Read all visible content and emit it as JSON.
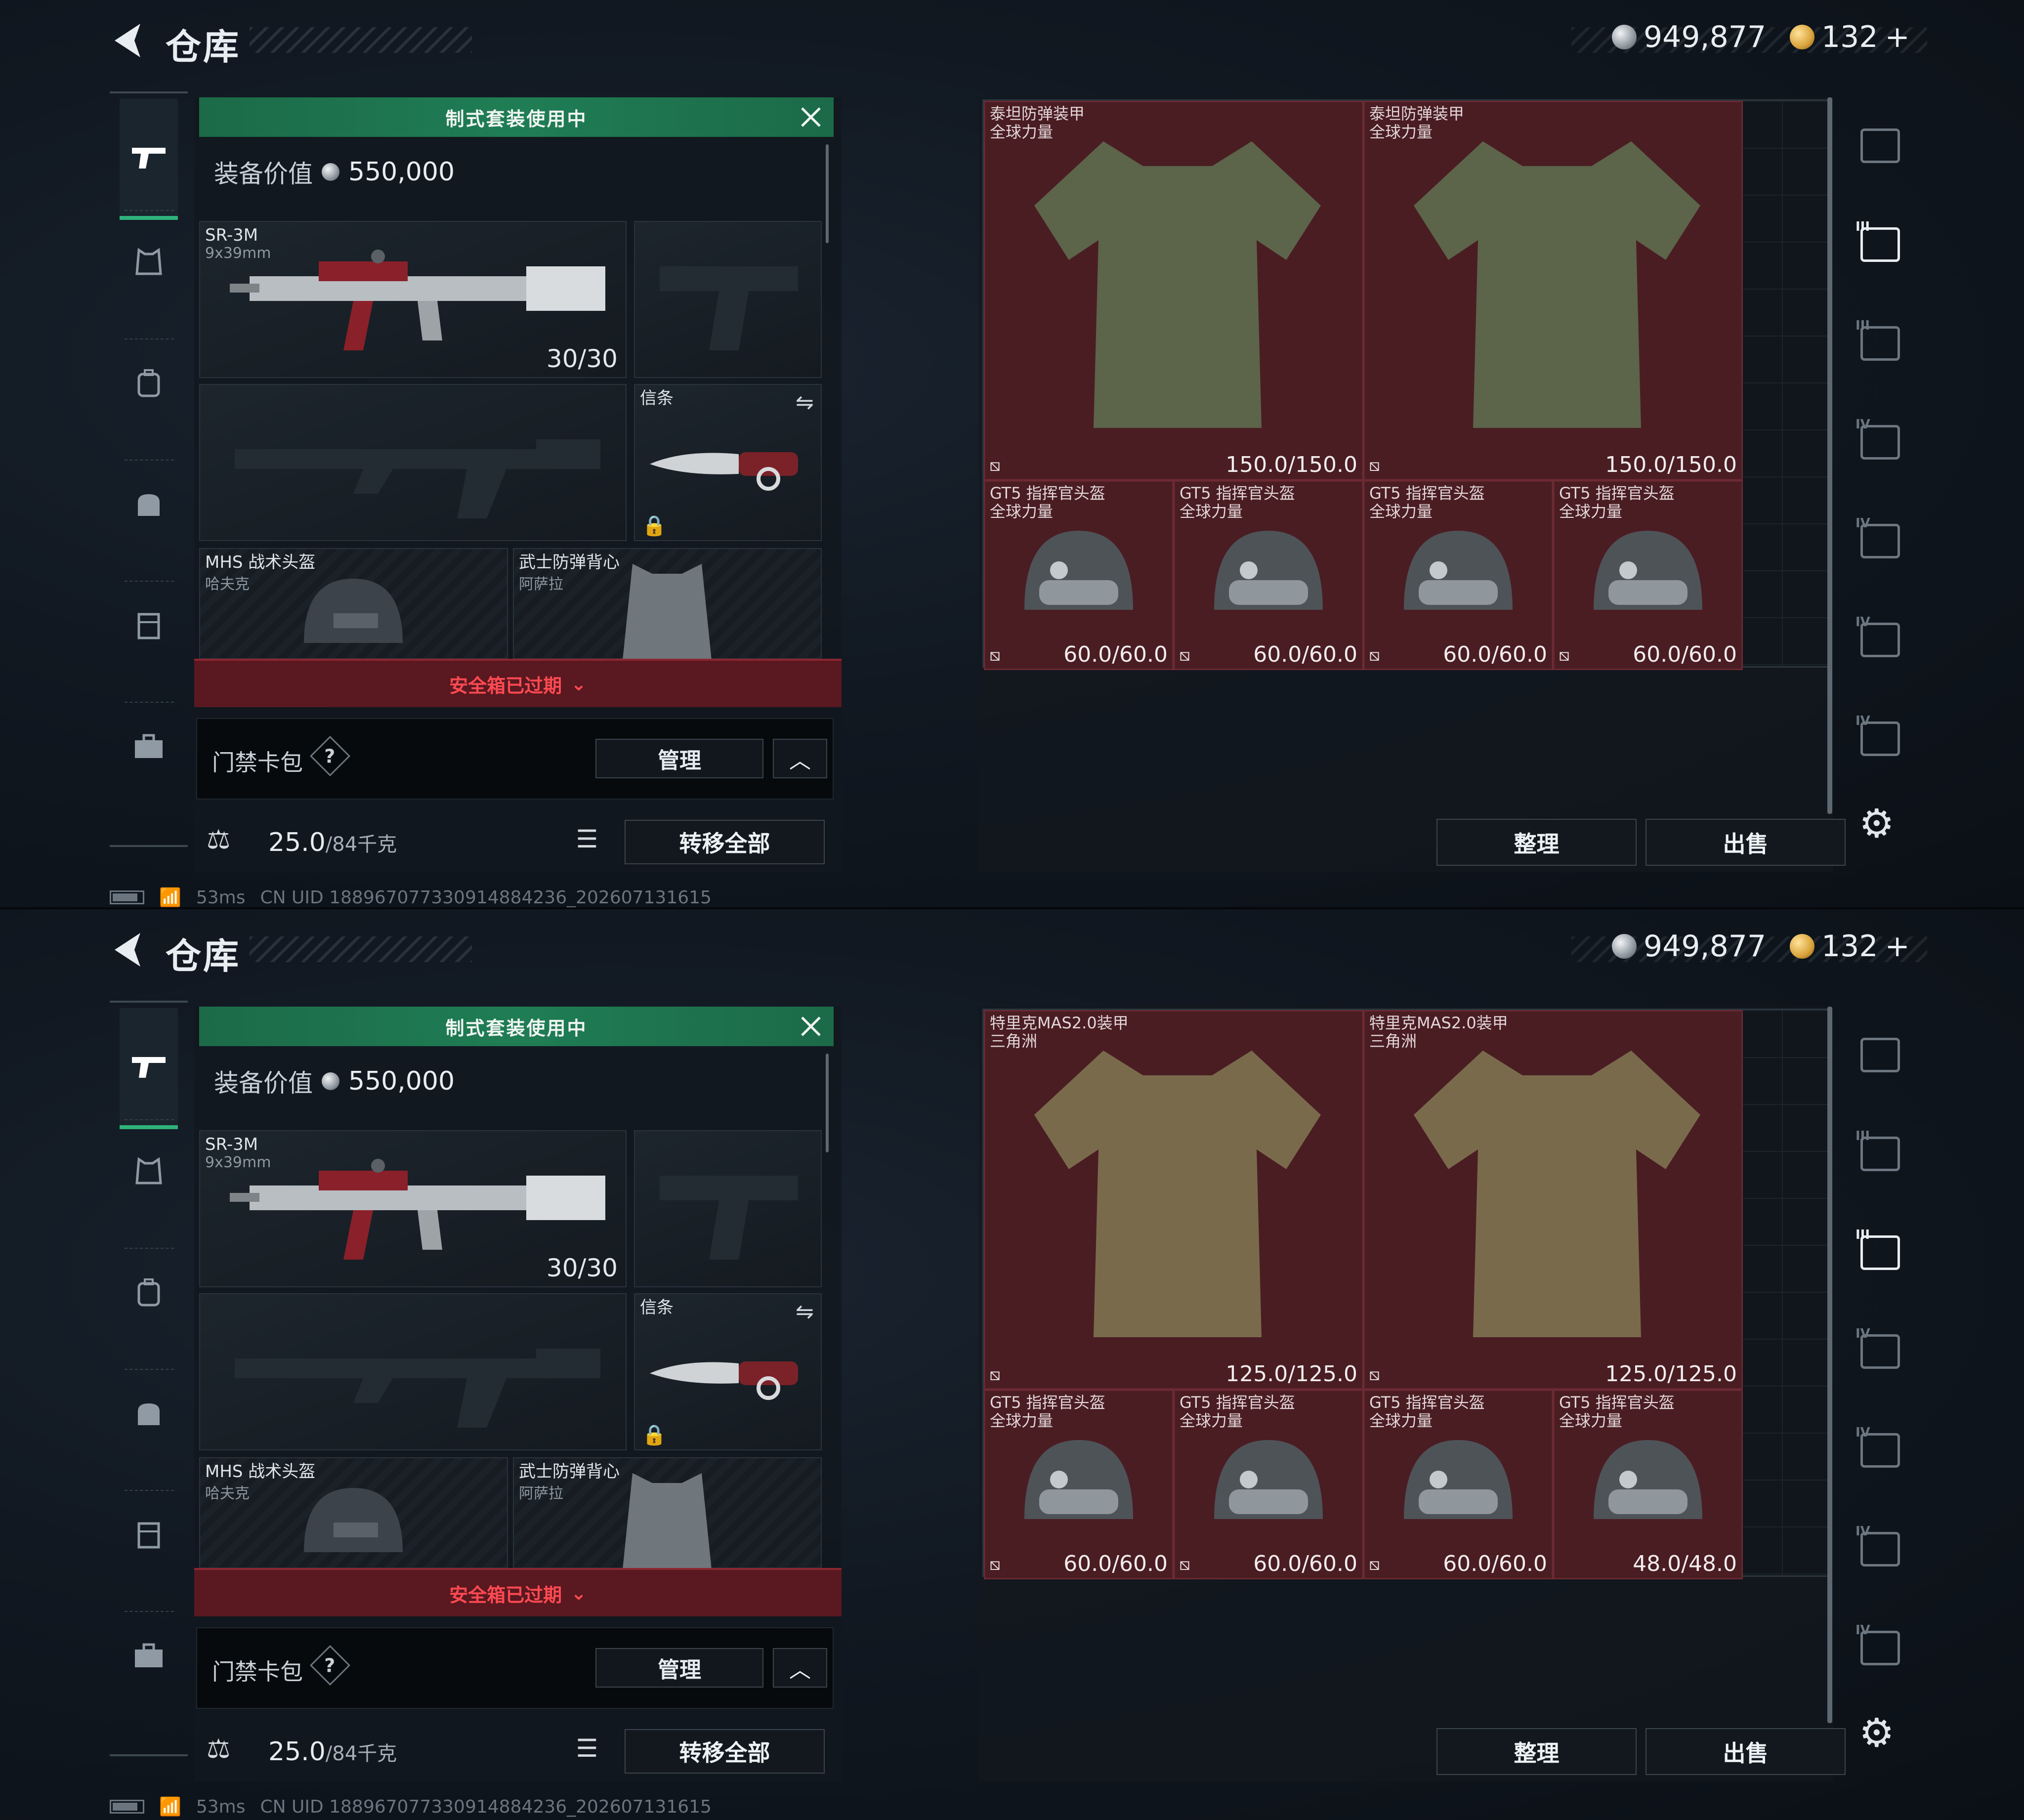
{
  "screens": [
    {
      "header": {
        "title": "仓库",
        "currency_silver": "949,877",
        "currency_gold": "132",
        "currency_plus": "+"
      },
      "loadout": {
        "banner": "制式套装使用中",
        "value_label": "装备价值",
        "value": "550,000",
        "primary": {
          "name": "SR-3M",
          "caliber": "9x39mm",
          "ammo": "30/30"
        },
        "melee": {
          "label": "信条"
        },
        "helmet": {
          "name": "MHS 战术头盔",
          "origin": "哈夫克"
        },
        "vest": {
          "name": "武士防弹背心",
          "origin": "阿萨拉"
        },
        "safe_box": "安全箱已过期",
        "card_pack": "门禁卡包",
        "help": "?",
        "manage": "管理",
        "weight": "25.0",
        "weight_cap": "/84千克",
        "transfer_all": "转移全部"
      },
      "status": {
        "ping": "53ms",
        "uid": "CN UID 188967077330914884236_202607131615"
      },
      "storage": {
        "armor": [
          {
            "name": "泰坦防弹装甲",
            "origin": "全球力量",
            "durability": "150.0/150.0"
          },
          {
            "name": "泰坦防弹装甲",
            "origin": "全球力量",
            "durability": "150.0/150.0"
          }
        ],
        "helmets": [
          {
            "name": "GT5 指挥官头盔",
            "origin": "全球力量",
            "durability": "60.0/60.0"
          },
          {
            "name": "GT5 指挥官头盔",
            "origin": "全球力量",
            "durability": "60.0/60.0"
          },
          {
            "name": "GT5 指挥官头盔",
            "origin": "全球力量",
            "durability": "60.0/60.0"
          },
          {
            "name": "GT5 指挥官头盔",
            "origin": "全球力量",
            "durability": "60.0/60.0"
          }
        ],
        "sort": "整理",
        "sell": "出售"
      },
      "rail": {
        "active_index": 1,
        "labels": [
          "",
          "III",
          "III",
          "IV",
          "IV",
          "IV",
          "IV"
        ]
      }
    },
    {
      "header": {
        "title": "仓库",
        "currency_silver": "949,877",
        "currency_gold": "132",
        "currency_plus": "+"
      },
      "loadout": {
        "banner": "制式套装使用中",
        "value_label": "装备价值",
        "value": "550,000",
        "primary": {
          "name": "SR-3M",
          "caliber": "9x39mm",
          "ammo": "30/30"
        },
        "melee": {
          "label": "信条"
        },
        "helmet": {
          "name": "MHS 战术头盔",
          "origin": "哈夫克"
        },
        "vest": {
          "name": "武士防弹背心",
          "origin": "阿萨拉"
        },
        "safe_box": "安全箱已过期",
        "card_pack": "门禁卡包",
        "help": "?",
        "manage": "管理",
        "weight": "25.0",
        "weight_cap": "/84千克",
        "transfer_all": "转移全部"
      },
      "status": {
        "ping": "53ms",
        "uid": "CN UID 188967077330914884236_202607131615"
      },
      "storage": {
        "armor": [
          {
            "name": "特里克MAS2.0装甲",
            "origin": "三角洲",
            "durability": "125.0/125.0"
          },
          {
            "name": "特里克MAS2.0装甲",
            "origin": "三角洲",
            "durability": "125.0/125.0"
          }
        ],
        "helmets": [
          {
            "name": "GT5 指挥官头盔",
            "origin": "全球力量",
            "durability": "60.0/60.0"
          },
          {
            "name": "GT5 指挥官头盔",
            "origin": "全球力量",
            "durability": "60.0/60.0"
          },
          {
            "name": "GT5 指挥官头盔",
            "origin": "全球力量",
            "durability": "60.0/60.0"
          },
          {
            "name": "GT5 指挥官头盔",
            "origin": "全球力量",
            "durability": "48.0/48.0"
          }
        ],
        "sort": "整理",
        "sell": "出售"
      },
      "rail": {
        "active_index": 2,
        "labels": [
          "",
          "III",
          "III",
          "IV",
          "IV",
          "IV",
          "IV"
        ]
      }
    }
  ]
}
